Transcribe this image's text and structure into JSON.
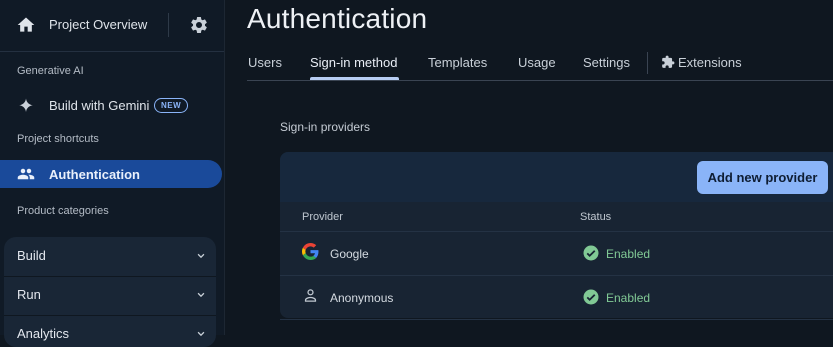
{
  "sidebar": {
    "project_title": "Project Overview",
    "section_generative_ai": "Generative AI",
    "gemini_label": "Build with Gemini",
    "gemini_badge": "NEW",
    "section_shortcuts": "Project shortcuts",
    "auth_label": "Authentication",
    "section_categories": "Product categories",
    "categories": [
      {
        "label": "Build"
      },
      {
        "label": "Run"
      },
      {
        "label": "Analytics"
      }
    ]
  },
  "main": {
    "title": "Authentication",
    "tabs": [
      {
        "label": "Users"
      },
      {
        "label": "Sign-in method"
      },
      {
        "label": "Templates"
      },
      {
        "label": "Usage"
      },
      {
        "label": "Settings"
      },
      {
        "label": "Extensions"
      }
    ],
    "active_tab": "Sign-in method",
    "providers_title": "Sign-in providers",
    "add_button": "Add new provider",
    "table": {
      "headers": [
        "Provider",
        "Status"
      ],
      "rows": [
        {
          "icon": "google-icon",
          "provider": "Google",
          "status": "Enabled"
        },
        {
          "icon": "person-icon",
          "provider": "Anonymous",
          "status": "Enabled"
        }
      ]
    }
  },
  "colors": {
    "accent": "#8ab4f8",
    "selected_nav": "#1a4a9a",
    "enabled_green": "#81c995"
  }
}
